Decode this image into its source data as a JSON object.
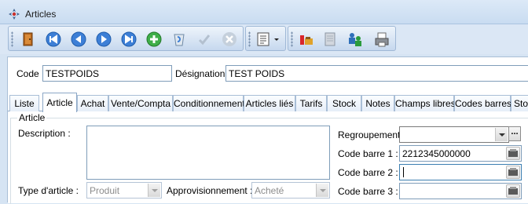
{
  "window": {
    "title": "Articles"
  },
  "toolbar": {
    "icons": [
      "exit-door-icon",
      "first-record-icon",
      "previous-record-icon",
      "next-record-icon",
      "last-record-icon",
      "add-record-icon",
      "delete-record-icon",
      "validate-icon",
      "cancel-icon",
      "list-menu-icon",
      "tools-icon",
      "documents-icon",
      "users-icon",
      "print-icon"
    ]
  },
  "header": {
    "code_label": "Code :",
    "code_value": "TESTPOIDS",
    "designation_label": "Désignation :",
    "designation_value": "TEST POIDS"
  },
  "tabs": [
    "Liste",
    "Article",
    "Achat",
    "Vente/Compta",
    "Conditionnement",
    "Articles liés",
    "Tarifs",
    "Stock",
    "Notes",
    "Champs libres",
    "Codes barres",
    "Sto"
  ],
  "active_tab": "Article",
  "article": {
    "group_title": "Article",
    "description_label": "Description :",
    "description_value": "",
    "type_label": "Type d'article :",
    "type_value": "Produit",
    "appro_label": "Approvisionnement :",
    "appro_value": "Acheté",
    "regroupement_label": "Regroupement :",
    "regroupement_value": "",
    "regroupement_more": "...",
    "barcode1_label": "Code barre 1 :",
    "barcode1_value": "2212345000000",
    "barcode2_label": "Code barre 2 :",
    "barcode2_value": "",
    "barcode3_label": "Code barre 3 :",
    "barcode3_value": ""
  }
}
